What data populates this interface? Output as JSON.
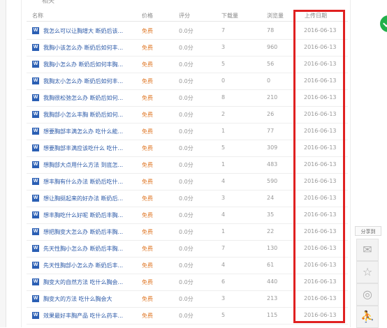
{
  "header": {
    "title_label": "名称",
    "price_label": "价格",
    "rating_label": "评分",
    "downloads_label": "下载量",
    "views_label": "浏览量",
    "date_label": "上传日期"
  },
  "top_strip_text": "相关",
  "file_icon_letter": "W",
  "rows": [
    {
      "title": "我怎么可以让胸增大 断奶后该...",
      "price": "免费",
      "rating": "0.0分",
      "downloads": "7",
      "views": "78",
      "date": "2016-06-13"
    },
    {
      "title": "我胸小该怎么办 断奶后如何丰...",
      "price": "免费",
      "rating": "0.0分",
      "downloads": "3",
      "views": "960",
      "date": "2016-06-13"
    },
    {
      "title": "我胸小怎么办 断奶后如何丰胸...",
      "price": "免费",
      "rating": "0.0分",
      "downloads": "5",
      "views": "56",
      "date": "2016-06-13"
    },
    {
      "title": "我胸太小怎么办 断奶后如何丰...",
      "price": "免费",
      "rating": "0.0分",
      "downloads": "0",
      "views": "0",
      "date": "2016-06-13"
    },
    {
      "title": "我胸很松弛怎么办 断奶后如何...",
      "price": "免费",
      "rating": "0.0分",
      "downloads": "8",
      "views": "210",
      "date": "2016-06-13"
    },
    {
      "title": "我胸部小怎么丰胸 断奶后如何...",
      "price": "免费",
      "rating": "0.0分",
      "downloads": "2",
      "views": "26",
      "date": "2016-06-13"
    },
    {
      "title": "想要胸部丰满怎么办 吃什么能...",
      "price": "免费",
      "rating": "0.0分",
      "downloads": "1",
      "views": "77",
      "date": "2016-06-13"
    },
    {
      "title": "想要胸部丰满应该吃什么 吃什...",
      "price": "免费",
      "rating": "0.0分",
      "downloads": "5",
      "views": "309",
      "date": "2016-06-13"
    },
    {
      "title": "想胸部大点用什么方法 到底怎...",
      "price": "免费",
      "rating": "0.0分",
      "downloads": "1",
      "views": "483",
      "date": "2016-06-13"
    },
    {
      "title": "想丰胸有什么办法 断奶后吃什...",
      "price": "免费",
      "rating": "0.0分",
      "downloads": "4",
      "views": "590",
      "date": "2016-06-13"
    },
    {
      "title": "想让胸挺起来的好办法 断奶后...",
      "price": "免费",
      "rating": "0.0分",
      "downloads": "3",
      "views": "24",
      "date": "2016-06-13"
    },
    {
      "title": "想丰胸吃什么好呢 断奶后丰胸...",
      "price": "免费",
      "rating": "0.0分",
      "downloads": "4",
      "views": "35",
      "date": "2016-06-13"
    },
    {
      "title": "想把胸变大怎么办 断奶后丰胸...",
      "price": "免费",
      "rating": "0.0分",
      "downloads": "1",
      "views": "22",
      "date": "2016-06-13"
    },
    {
      "title": "先天性胸小怎么办 断奶后丰胸...",
      "price": "免费",
      "rating": "0.0分",
      "downloads": "7",
      "views": "130",
      "date": "2016-06-13"
    },
    {
      "title": "先天性胸部小怎么办 断奶后丰...",
      "price": "免费",
      "rating": "0.0分",
      "downloads": "4",
      "views": "61",
      "date": "2016-06-13"
    },
    {
      "title": "胸变大的自然方法 吃什么胸会...",
      "price": "免费",
      "rating": "0.0分",
      "downloads": "6",
      "views": "440",
      "date": "2016-06-13"
    },
    {
      "title": "胸变大的方法 吃什么胸会大",
      "price": "免费",
      "rating": "0.0分",
      "downloads": "3",
      "views": "213",
      "date": "2016-06-13"
    },
    {
      "title": "效果最好丰胸产品 吃什么药丰...",
      "price": "免费",
      "rating": "0.0分",
      "downloads": "5",
      "views": "115",
      "date": "2016-06-13"
    }
  ],
  "share": {
    "label": "分享到",
    "buttons": [
      {
        "icon": "wechat-icon",
        "glyph": "✉"
      },
      {
        "icon": "star-icon",
        "glyph": "☆"
      },
      {
        "icon": "weibo-icon",
        "glyph": "◎"
      },
      {
        "icon": "person-icon",
        "glyph": "⛹"
      }
    ]
  },
  "colors": {
    "link": "#2c5aa8",
    "price": "#e07a2a",
    "highlight": "#e02020",
    "word_icon": "#2b5fb4"
  }
}
